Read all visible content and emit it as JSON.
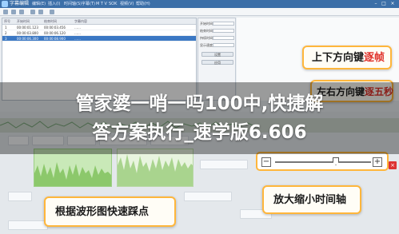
{
  "window": {
    "title": "字幕编辑",
    "menu": [
      "编辑(E)",
      "插入(I)",
      "时间轴(S)",
      "字幕(T)",
      "M T V",
      "SOK",
      "视频(V)",
      "帮助(H)"
    ],
    "controls": [
      "–",
      "□",
      "×"
    ]
  },
  "list": {
    "headers": [
      "序号",
      "开始时间",
      "结束时间",
      "字幕内容"
    ],
    "rows": [
      {
        "num": "1",
        "start": "00:00:01.123",
        "end": "00:00:03.456",
        "text": "……"
      },
      {
        "num": "2",
        "start": "00:00:03.800",
        "end": "00:00:06.120",
        "text": "……"
      },
      {
        "num": "3",
        "start": "00:00:06.300",
        "end": "00:00:08.900",
        "text": "……"
      }
    ]
  },
  "panel": {
    "labels": [
      "开始时间",
      "结束时间",
      "持续时间",
      "显示速度"
    ],
    "buttons": [
      "设置",
      "应用"
    ]
  },
  "callouts": {
    "top": {
      "prefix": "上下方向键",
      "accent": "逐帧"
    },
    "middle": {
      "prefix": "左右方向键",
      "accent": "逐五秒"
    },
    "bottom_left": "根据波形图快速踩点",
    "bottom_right": "放大缩小时间轴"
  },
  "zoom": {
    "minus": "−",
    "plus": "+",
    "close": "×"
  },
  "headline": {
    "line1": "管家婆一哨一吗100中,快捷解",
    "line2": "答方案执行_速学版6.606"
  },
  "colors": {
    "titlebar": "#3c6fa8",
    "accent_border": "#ffb63b",
    "accent_text": "#e0322b",
    "waveform": "#c9e9b8"
  }
}
